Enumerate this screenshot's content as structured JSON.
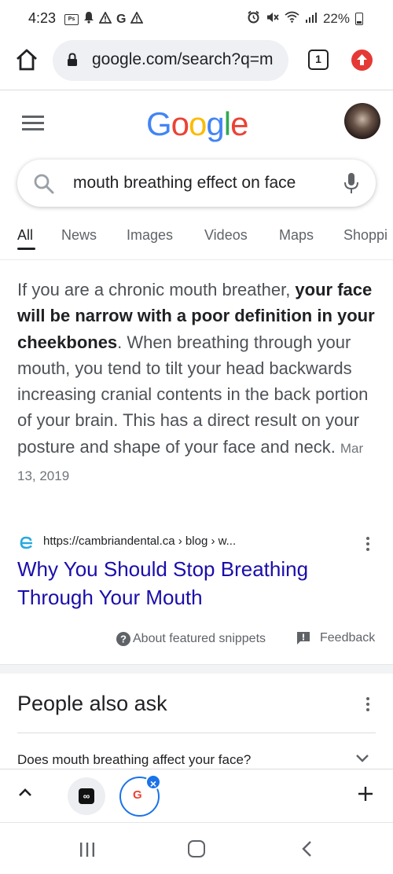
{
  "status_bar": {
    "time": "4:23",
    "battery": "22%",
    "left_icons": [
      "data-saver-icon",
      "notification-bell-icon",
      "warning-icon",
      "g-icon",
      "warning-icon"
    ],
    "right_icons": [
      "alarm-icon",
      "mute-icon",
      "wifi-icon",
      "signal-icon",
      "battery-icon"
    ]
  },
  "browser": {
    "url": "google.com/search?q=m",
    "tab_count": "1"
  },
  "google": {
    "logo_letters": [
      "G",
      "o",
      "o",
      "g",
      "l",
      "e"
    ],
    "logo_colors": [
      "#4285F4",
      "#EA4335",
      "#FBBC05",
      "#4285F4",
      "#34A853",
      "#EA4335"
    ],
    "search_query": "mouth breathing effect on face"
  },
  "search_tabs": [
    {
      "label": "All",
      "active": true
    },
    {
      "label": "News",
      "active": false
    },
    {
      "label": "Images",
      "active": false
    },
    {
      "label": "Videos",
      "active": false
    },
    {
      "label": "Maps",
      "active": false
    },
    {
      "label": "Shoppi",
      "active": false
    }
  ],
  "featured_snippet": {
    "text_before": "If you are a chronic mouth breather, ",
    "text_bold": "your face will be narrow with a poor definition in your cheekbones",
    "text_after": ". When breathing through your mouth, you tend to tilt your head backwards increasing cranial contents in the back portion of your brain. This has a direct result on your posture and shape of your face and neck.",
    "date": "Mar 13, 2019",
    "source_url": "https://cambriandental.ca › blog › w...",
    "title": "Why You Should Stop Breathing Through Your Mouth",
    "about_label": "About featured snippets",
    "feedback_label": "Feedback"
  },
  "people_also_ask": {
    "title": "People also ask",
    "questions": [
      "Does mouth breathing affect your face?"
    ]
  },
  "colors": {
    "link_blue": "#1a0dab",
    "accent_blue": "#1a73e8",
    "update_red": "#e53935"
  }
}
